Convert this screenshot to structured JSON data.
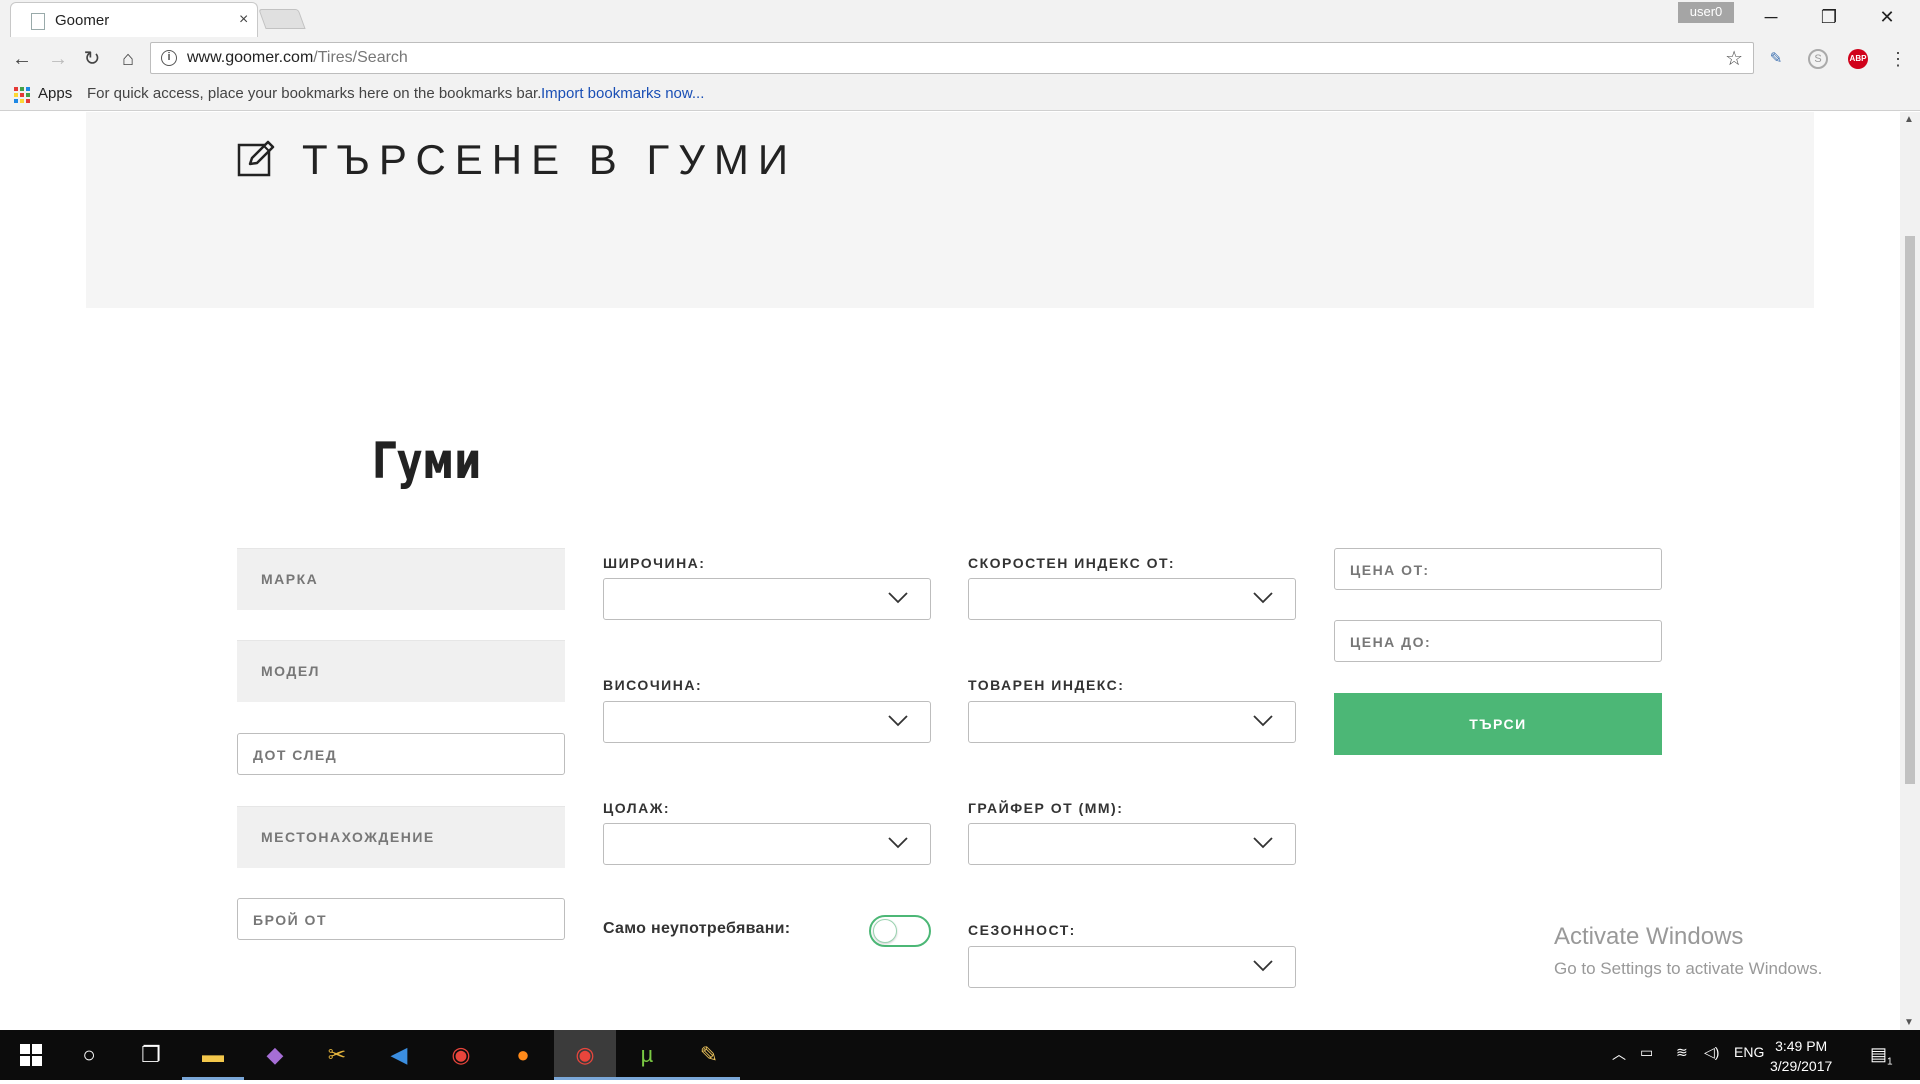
{
  "browser": {
    "tab_title": "Goomer",
    "tab_close": "×",
    "user_name": "user0",
    "window_buttons": {
      "minimize": "─",
      "restore": "❐",
      "close": "✕"
    },
    "url_host": "www.goomer.com",
    "url_path": "/Tires/Search",
    "bookmarks_bar": {
      "apps_label": "Apps",
      "hint": "For quick access, place your bookmarks here on the bookmarks bar.",
      "import_link": "Import bookmarks now..."
    },
    "extensions": {
      "abp": "ABP",
      "skype": "S"
    }
  },
  "page": {
    "hero_title": "ТЪРСЕНЕ В ГУМИ",
    "section_title": "Гуми",
    "left_fields": [
      {
        "label": "МАРКА"
      },
      {
        "label": "МОДЕЛ"
      },
      {
        "label": "ДОТ СЛЕД"
      },
      {
        "label": "МЕСТОНАХОЖДЕНИЕ"
      },
      {
        "label": "БРОЙ ОТ"
      }
    ],
    "middle_selects": [
      {
        "label": "ШИРОЧИНА:",
        "value": ""
      },
      {
        "label": "ВИСОЧИНА:",
        "value": ""
      },
      {
        "label": "ЦОЛАЖ:",
        "value": ""
      }
    ],
    "unused_only_label": "Само неупотребявани:",
    "unused_only_value": false,
    "right_selects": [
      {
        "label": "СКОРОСТЕН ИНДЕКС ОТ:",
        "value": ""
      },
      {
        "label": "ТОВАРЕН ИНДЕКС:",
        "value": ""
      },
      {
        "label": "ГРАЙФЕР ОТ (ММ):",
        "value": ""
      },
      {
        "label": "СЕЗОННОСТ:",
        "value": ""
      }
    ],
    "price_from": "ЦЕНА ОТ:",
    "price_to": "ЦЕНА ДО:",
    "search_button": "ТЪРСИ",
    "accent_color": "#4cb776"
  },
  "watermark": {
    "line1": "Activate Windows",
    "line2": "Go to Settings to activate Windows."
  },
  "taskbar": {
    "language": "ENG",
    "time": "3:49 PM",
    "date": "3/29/2017",
    "notification_count": "1"
  }
}
